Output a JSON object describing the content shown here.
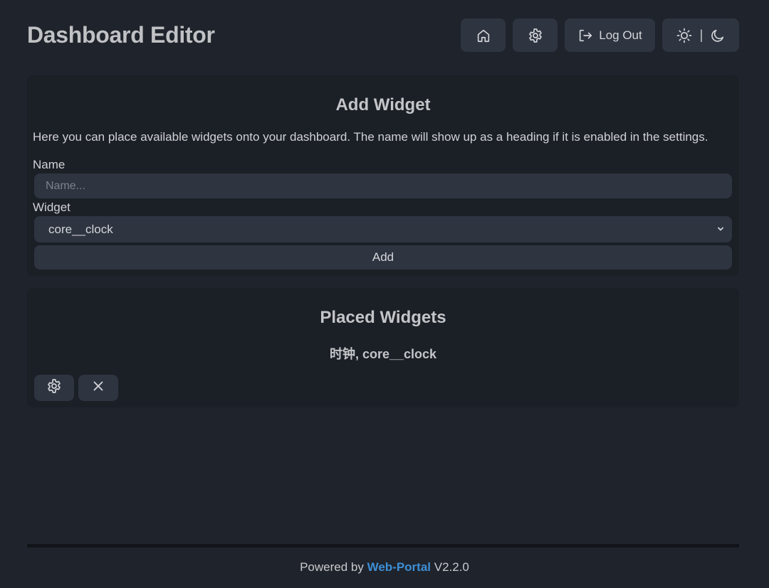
{
  "header": {
    "title": "Dashboard Editor",
    "home_icon": "home-icon",
    "settings_icon": "gear-icon",
    "logout_label": "Log Out",
    "logout_icon": "logout-icon",
    "theme_separator": "|"
  },
  "add_widget": {
    "title": "Add Widget",
    "description": "Here you can place available widgets onto your dashboard. The name will show up as a heading if it is enabled in the settings.",
    "name_label": "Name",
    "name_placeholder": "Name...",
    "widget_label": "Widget",
    "widget_selected": "core__clock",
    "add_label": "Add"
  },
  "placed_widgets": {
    "title": "Placed Widgets",
    "items": [
      {
        "label": "时钟, core__clock"
      }
    ]
  },
  "footer": {
    "prefix": "Powered by ",
    "link": "Web-Portal",
    "version": " V2.2.0"
  },
  "colors": {
    "background": "#1f232b",
    "card": "#1b1f26",
    "button": "#2e3440",
    "link": "#3d8fd6"
  }
}
